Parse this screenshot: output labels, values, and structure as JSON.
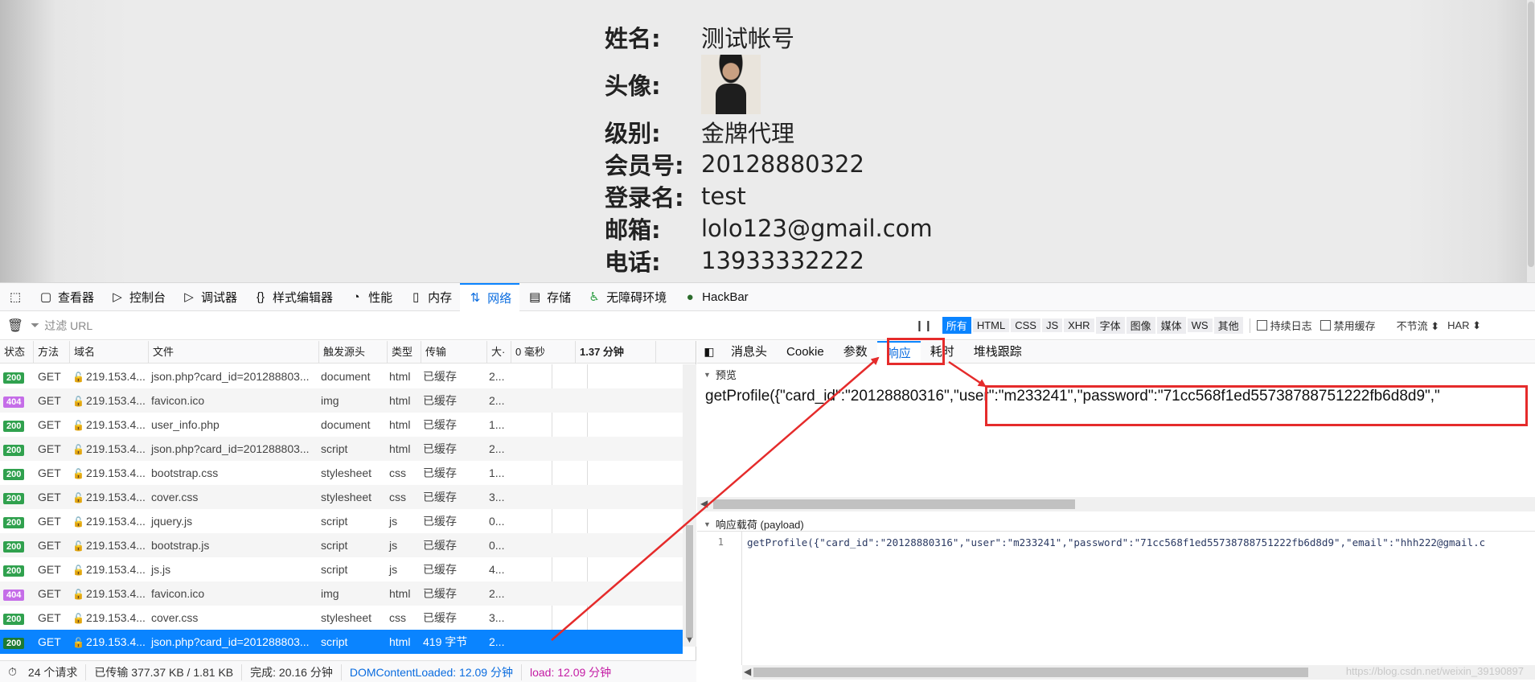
{
  "profile": {
    "rows": [
      {
        "label": "姓名:",
        "value": "测试帐号"
      },
      {
        "label": "级别:",
        "value": "金牌代理"
      },
      {
        "label": "会员号:",
        "value": "20128880322"
      },
      {
        "label": "登录名:",
        "value": "test"
      },
      {
        "label": "邮箱:",
        "value": "lolo123@gmail.com"
      },
      {
        "label": "电话:",
        "value": "13933332222"
      }
    ],
    "avatar_label": "头像:"
  },
  "devtools": {
    "tools": [
      {
        "icon": "▢",
        "label": "查看器"
      },
      {
        "icon": "▷",
        "label": "控制台"
      },
      {
        "icon": "▷",
        "label": "调试器"
      },
      {
        "icon": "{}",
        "label": "样式编辑器"
      },
      {
        "icon": "◔",
        "label": "性能"
      },
      {
        "icon": "▯",
        "label": "内存"
      },
      {
        "icon": "⇅",
        "label": "网络"
      },
      {
        "icon": "▤",
        "label": "存储"
      },
      {
        "icon": "♿",
        "label": "无障碍环境"
      },
      {
        "icon": "●",
        "label": "HackBar"
      }
    ],
    "filter_placeholder": "过滤 URL",
    "filter_tabs": [
      "所有",
      "HTML",
      "CSS",
      "JS",
      "XHR",
      "字体",
      "图像",
      "媒体",
      "WS",
      "其他"
    ],
    "persist_log": "持续日志",
    "disable_cache": "禁用缓存",
    "throttle": "不节流 ⬍",
    "har": "HAR ⬍",
    "columns": {
      "status": "状态",
      "method": "方法",
      "domain": "域名",
      "file": "文件",
      "cause": "触发源头",
      "type": "类型",
      "transfer": "传输",
      "size": "大·",
      "t0": "0 毫秒",
      "t1": "1.37 分钟"
    },
    "requests": [
      {
        "status": "200",
        "method": "GET",
        "domain": "219.153.4...",
        "file": "json.php?card_id=201288803...",
        "cause": "document",
        "type": "html",
        "transfer": "已缓存",
        "size": "2..."
      },
      {
        "status": "404",
        "method": "GET",
        "domain": "219.153.4...",
        "file": "favicon.ico",
        "cause": "img",
        "type": "html",
        "transfer": "已缓存",
        "size": "2..."
      },
      {
        "status": "200",
        "method": "GET",
        "domain": "219.153.4...",
        "file": "user_info.php",
        "cause": "document",
        "type": "html",
        "transfer": "已缓存",
        "size": "1..."
      },
      {
        "status": "200",
        "method": "GET",
        "domain": "219.153.4...",
        "file": "json.php?card_id=201288803...",
        "cause": "script",
        "type": "html",
        "transfer": "已缓存",
        "size": "2..."
      },
      {
        "status": "200",
        "method": "GET",
        "domain": "219.153.4...",
        "file": "bootstrap.css",
        "cause": "stylesheet",
        "type": "css",
        "transfer": "已缓存",
        "size": "1..."
      },
      {
        "status": "200",
        "method": "GET",
        "domain": "219.153.4...",
        "file": "cover.css",
        "cause": "stylesheet",
        "type": "css",
        "transfer": "已缓存",
        "size": "3..."
      },
      {
        "status": "200",
        "method": "GET",
        "domain": "219.153.4...",
        "file": "jquery.js",
        "cause": "script",
        "type": "js",
        "transfer": "已缓存",
        "size": "0..."
      },
      {
        "status": "200",
        "method": "GET",
        "domain": "219.153.4...",
        "file": "bootstrap.js",
        "cause": "script",
        "type": "js",
        "transfer": "已缓存",
        "size": "0..."
      },
      {
        "status": "200",
        "method": "GET",
        "domain": "219.153.4...",
        "file": "js.js",
        "cause": "script",
        "type": "js",
        "transfer": "已缓存",
        "size": "4..."
      },
      {
        "status": "404",
        "method": "GET",
        "domain": "219.153.4...",
        "file": "favicon.ico",
        "cause": "img",
        "type": "html",
        "transfer": "已缓存",
        "size": "2..."
      },
      {
        "status": "200",
        "method": "GET",
        "domain": "219.153.4...",
        "file": "cover.css",
        "cause": "stylesheet",
        "type": "css",
        "transfer": "已缓存",
        "size": "3..."
      },
      {
        "status": "200",
        "method": "GET",
        "domain": "219.153.4...",
        "file": "json.php?card_id=201288803...",
        "cause": "script",
        "type": "html",
        "transfer": "419 字节",
        "size": "2..."
      }
    ],
    "status": {
      "requests": "24 个请求",
      "transferred": "已传输 377.37 KB / 1.81 KB",
      "finish": "完成: 20.16 分钟",
      "dcl": "DOMContentLoaded: 12.09 分钟",
      "load": "load: 12.09 分钟"
    },
    "detail_tabs": [
      "消息头",
      "Cookie",
      "参数",
      "响应",
      "耗时",
      "堆栈跟踪"
    ],
    "preview_label": "预览",
    "preview_text": "getProfile({\"card_id\":\"20128880316\",\"user\":\"m233241\",\"password\":\"71cc568f1ed55738788751222fb6d8d9\",\"",
    "payload_label": "响应载荷 (payload)",
    "line_no": "1",
    "payload_code": "getProfile({\"card_id\":\"20128880316\",\"user\":\"m233241\",\"password\":\"71cc568f1ed55738788751222fb6d8d9\",\"email\":\"hhh222@gmail.c"
  },
  "watermark": "https://blog.csdn.net/weixin_39190897",
  "colors": {
    "accent": "#0a84ff",
    "annotation": "#e52b2b"
  }
}
